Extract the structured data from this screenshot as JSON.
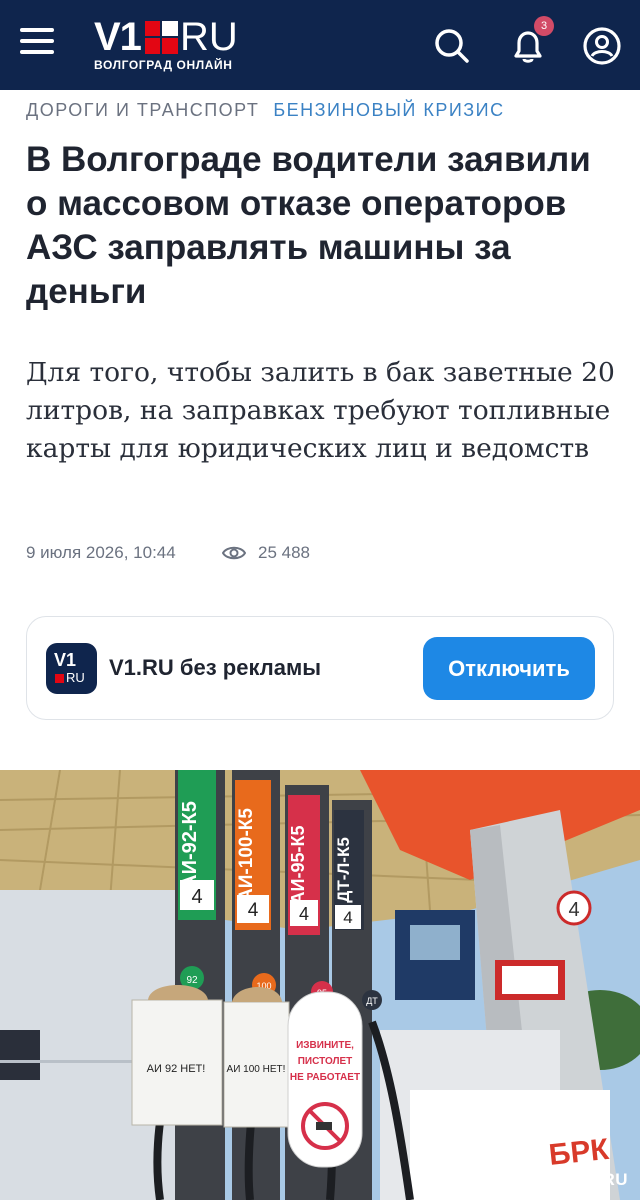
{
  "header": {
    "logo_main": "V1",
    "logo_ru": "RU",
    "logo_sub": "ВОЛГОГРАД ОНЛАЙН",
    "notifications_count": "3"
  },
  "article": {
    "rubric_primary": "ДОРОГИ И ТРАНСПОРТ",
    "rubric_secondary": "БЕНЗИНОВЫЙ КРИЗИС",
    "title": "В Волгограде водители заявили о массовом отказе операторов АЗС заправлять машины за деньги",
    "lead": "Для того, чтобы залить в бак заветные 20 литров, на заправках требуют топливные карты для юридических лиц и ведомств",
    "date": "9 июля 2026, 10:44",
    "views": "25 488"
  },
  "promo": {
    "logo_top": "V1",
    "logo_bottom": "RU",
    "text": "V1.RU без рекламы",
    "button_label": "Отключить"
  },
  "photo": {
    "pump_labels": [
      "АИ-92-К5",
      "АИ-100-К5",
      "АИ-95-К5",
      "ДТ-Л-К5"
    ],
    "pump_numbers": [
      "4",
      "4",
      "4",
      "4"
    ],
    "nozzle_numbers": [
      "92",
      "100",
      "95",
      "ДТ"
    ],
    "sign_1": "АИ 92 НЕТ!",
    "sign_2": "АИ 100 НЕТ!",
    "sign_3_line1": "ИЗВИНИТЕ,",
    "sign_3_line2": "ПИСТОЛЕТ",
    "sign_3_line3": "НЕ РАБОТАЕТ",
    "column_number": "4",
    "brand": "БРК",
    "watermark": "CHITA.RU"
  },
  "colors": {
    "header_bg": "#0f254d",
    "accent_red": "#e30613",
    "link_blue": "#3b82c4",
    "button_blue": "#1e88e5"
  }
}
